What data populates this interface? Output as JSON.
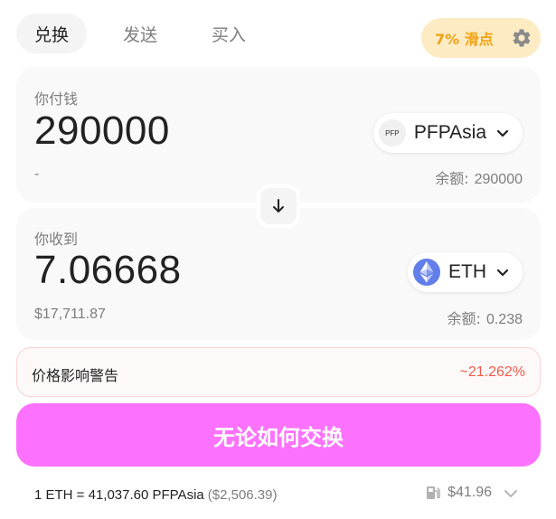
{
  "tabs": [
    {
      "label": "兑换",
      "active": true
    },
    {
      "label": "发送",
      "active": false
    },
    {
      "label": "买入",
      "active": false
    }
  ],
  "slippage": {
    "label": "7% 滑点",
    "icon": "gear-icon"
  },
  "pay": {
    "label": "你付钱",
    "amount": "290000",
    "usd_value": "-",
    "token": {
      "symbol": "PFPAsia",
      "icon_text": "PFP"
    },
    "balance_label": "余额:",
    "balance_value": "290000"
  },
  "receive": {
    "label": "你收到",
    "amount": "7.06668",
    "usd_value": "$17,711.87",
    "token": {
      "symbol": "ETH",
      "icon": "eth-icon"
    },
    "balance_label": "余额:",
    "balance_value": "0.238"
  },
  "price_impact": {
    "label": "价格影响警告",
    "value": "~21.262%"
  },
  "swap_button": {
    "label": "无论如何交换"
  },
  "footer": {
    "rate": "1 ETH = 41,037.60 PFPAsia",
    "rate_usd": "($2,506.39)",
    "gas_fee": "$41.96"
  },
  "colors": {
    "accent_pink": "#fc72ff",
    "slippage_bg": "#fdebc4",
    "slippage_text": "#f0a214",
    "warning_red": "#f05c4b",
    "eth_blue": "#627eea"
  }
}
